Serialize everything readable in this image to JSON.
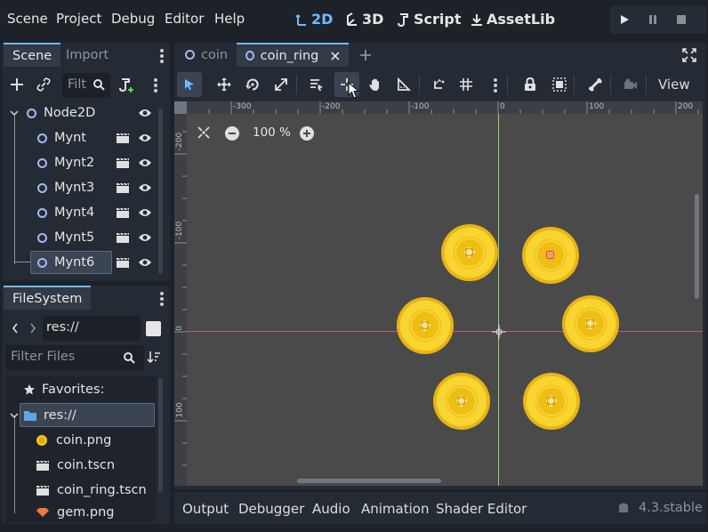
{
  "menubar": {
    "items": [
      "Scene",
      "Project",
      "Debug",
      "Editor",
      "Help"
    ],
    "workspaces": [
      "2D",
      "3D",
      "Script",
      "AssetLib"
    ],
    "active_workspace": "2D"
  },
  "scene_dock": {
    "tabs": [
      "Scene",
      "Import"
    ],
    "filter_placeholder": "Filt",
    "tree": [
      {
        "label": "Node2D",
        "root": true
      },
      {
        "label": "Mynt"
      },
      {
        "label": "Mynt2"
      },
      {
        "label": "Mynt3"
      },
      {
        "label": "Mynt4"
      },
      {
        "label": "Mynt5"
      },
      {
        "label": "Mynt6",
        "selected": true
      }
    ]
  },
  "filesystem": {
    "tab": "FileSystem",
    "path": "res://",
    "filter_placeholder": "Filter Files",
    "items": [
      {
        "label": "Favorites:",
        "icon": "star-icon"
      },
      {
        "label": "res://",
        "icon": "folder-icon",
        "selected": true
      },
      {
        "label": "coin.png",
        "icon": "coin-image-icon"
      },
      {
        "label": "coin.tscn",
        "icon": "clapperboard-icon"
      },
      {
        "label": "coin_ring.tscn",
        "icon": "clapperboard-icon"
      },
      {
        "label": "gem.png",
        "icon": "gem-image-icon"
      }
    ]
  },
  "editor_tabs": [
    "coin",
    "coin_ring"
  ],
  "active_editor_tab": "coin_ring",
  "toolbar": {
    "view_label": "View"
  },
  "viewport": {
    "zoom": "100 %",
    "ruler_top": [
      "-300",
      "-200",
      "-100",
      "0",
      "100",
      "200"
    ],
    "ruler_left": [
      "-200",
      "-100",
      "0",
      "100"
    ]
  },
  "bottom_panel": {
    "tabs": [
      "Output",
      "Debugger",
      "Audio",
      "Animation",
      "Shader Editor"
    ],
    "version": "4.3.stable"
  },
  "colors": {
    "accent": "#70bafa",
    "coin": "#f8d531",
    "x_axis": "#c25a73",
    "y_axis": "#8fd26a"
  }
}
